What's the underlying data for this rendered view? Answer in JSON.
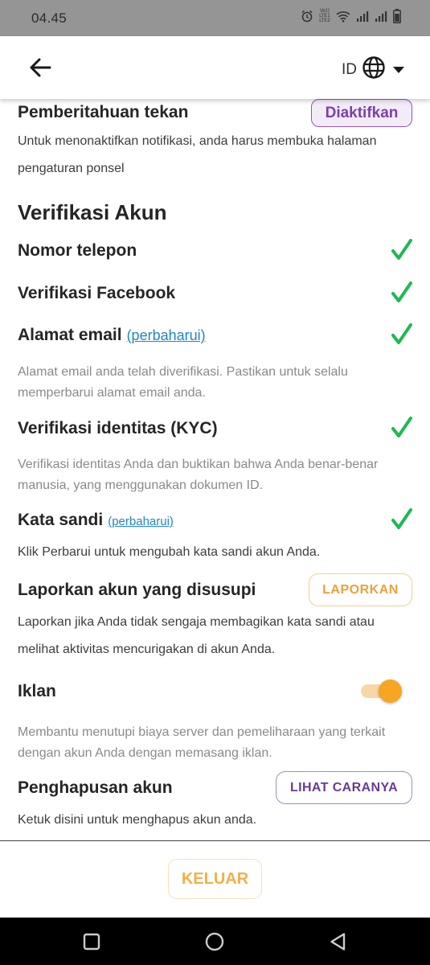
{
  "status_bar": {
    "time": "04.45",
    "volte_top": "Vo)) LTE1",
    "volte_bottom": "LTE2",
    "icons": [
      "alarm-icon",
      "volte-icon",
      "wifi-icon",
      "signal-icon",
      "signal-icon",
      "battery-icon"
    ]
  },
  "header": {
    "back_icon": "arrow-left-icon",
    "language_code": "ID",
    "language_icon": "globe-icon",
    "dropdown_icon": "caret-down-icon"
  },
  "push": {
    "title": "Pemberitahuan tekan",
    "status_label": "Diaktifkan",
    "description": "Untuk menonaktifkan notifikasi, anda harus membuka halaman pengaturan ponsel"
  },
  "verification": {
    "section_title": "Verifikasi Akun",
    "phone": {
      "title": "Nomor telepon",
      "verified": true
    },
    "facebook": {
      "title": "Verifikasi Facebook",
      "verified": true
    },
    "email": {
      "title": "Alamat email",
      "link_label": "(perbaharui)",
      "verified": true,
      "description": "Alamat email anda telah diverifikasi. Pastikan untuk selalu memperbarui alamat email anda."
    },
    "kyc": {
      "title": "Verifikasi identitas (KYC)",
      "verified": true,
      "description": "Verifikasi identitas Anda dan buktikan bahwa Anda benar-benar manusia, yang menggunakan dokumen ID."
    },
    "password": {
      "title": "Kata sandi",
      "link_label": "(perbaharui)",
      "verified": true,
      "description": "Klik Perbarui untuk mengubah kata sandi akun Anda."
    }
  },
  "report": {
    "title": "Laporkan akun yang disusupi",
    "button_label": "LAPORKAN",
    "description": "Laporkan jika Anda tidak sengaja membagikan kata sandi atau melihat aktivitas mencurigakan di akun Anda."
  },
  "ads": {
    "title": "Iklan",
    "enabled": true,
    "description": "Membantu menutupi biaya server dan pemeliharaan yang terkait dengan akun Anda dengan memasang iklan."
  },
  "deletion": {
    "title": "Penghapusan akun",
    "button_label": "LIHAT CARANYA",
    "description": "Ketuk disini untuk menghapus akun anda."
  },
  "footer": {
    "logout_label": "KELUAR"
  },
  "nav_bar": {
    "icons": [
      "recents-square-icon",
      "home-circle-icon",
      "back-triangle-icon"
    ]
  },
  "colors": {
    "check_green": "#1db954",
    "accent_orange": "#f5a623",
    "accent_purple": "#7c3fa8",
    "link_blue": "#1f86c8"
  }
}
